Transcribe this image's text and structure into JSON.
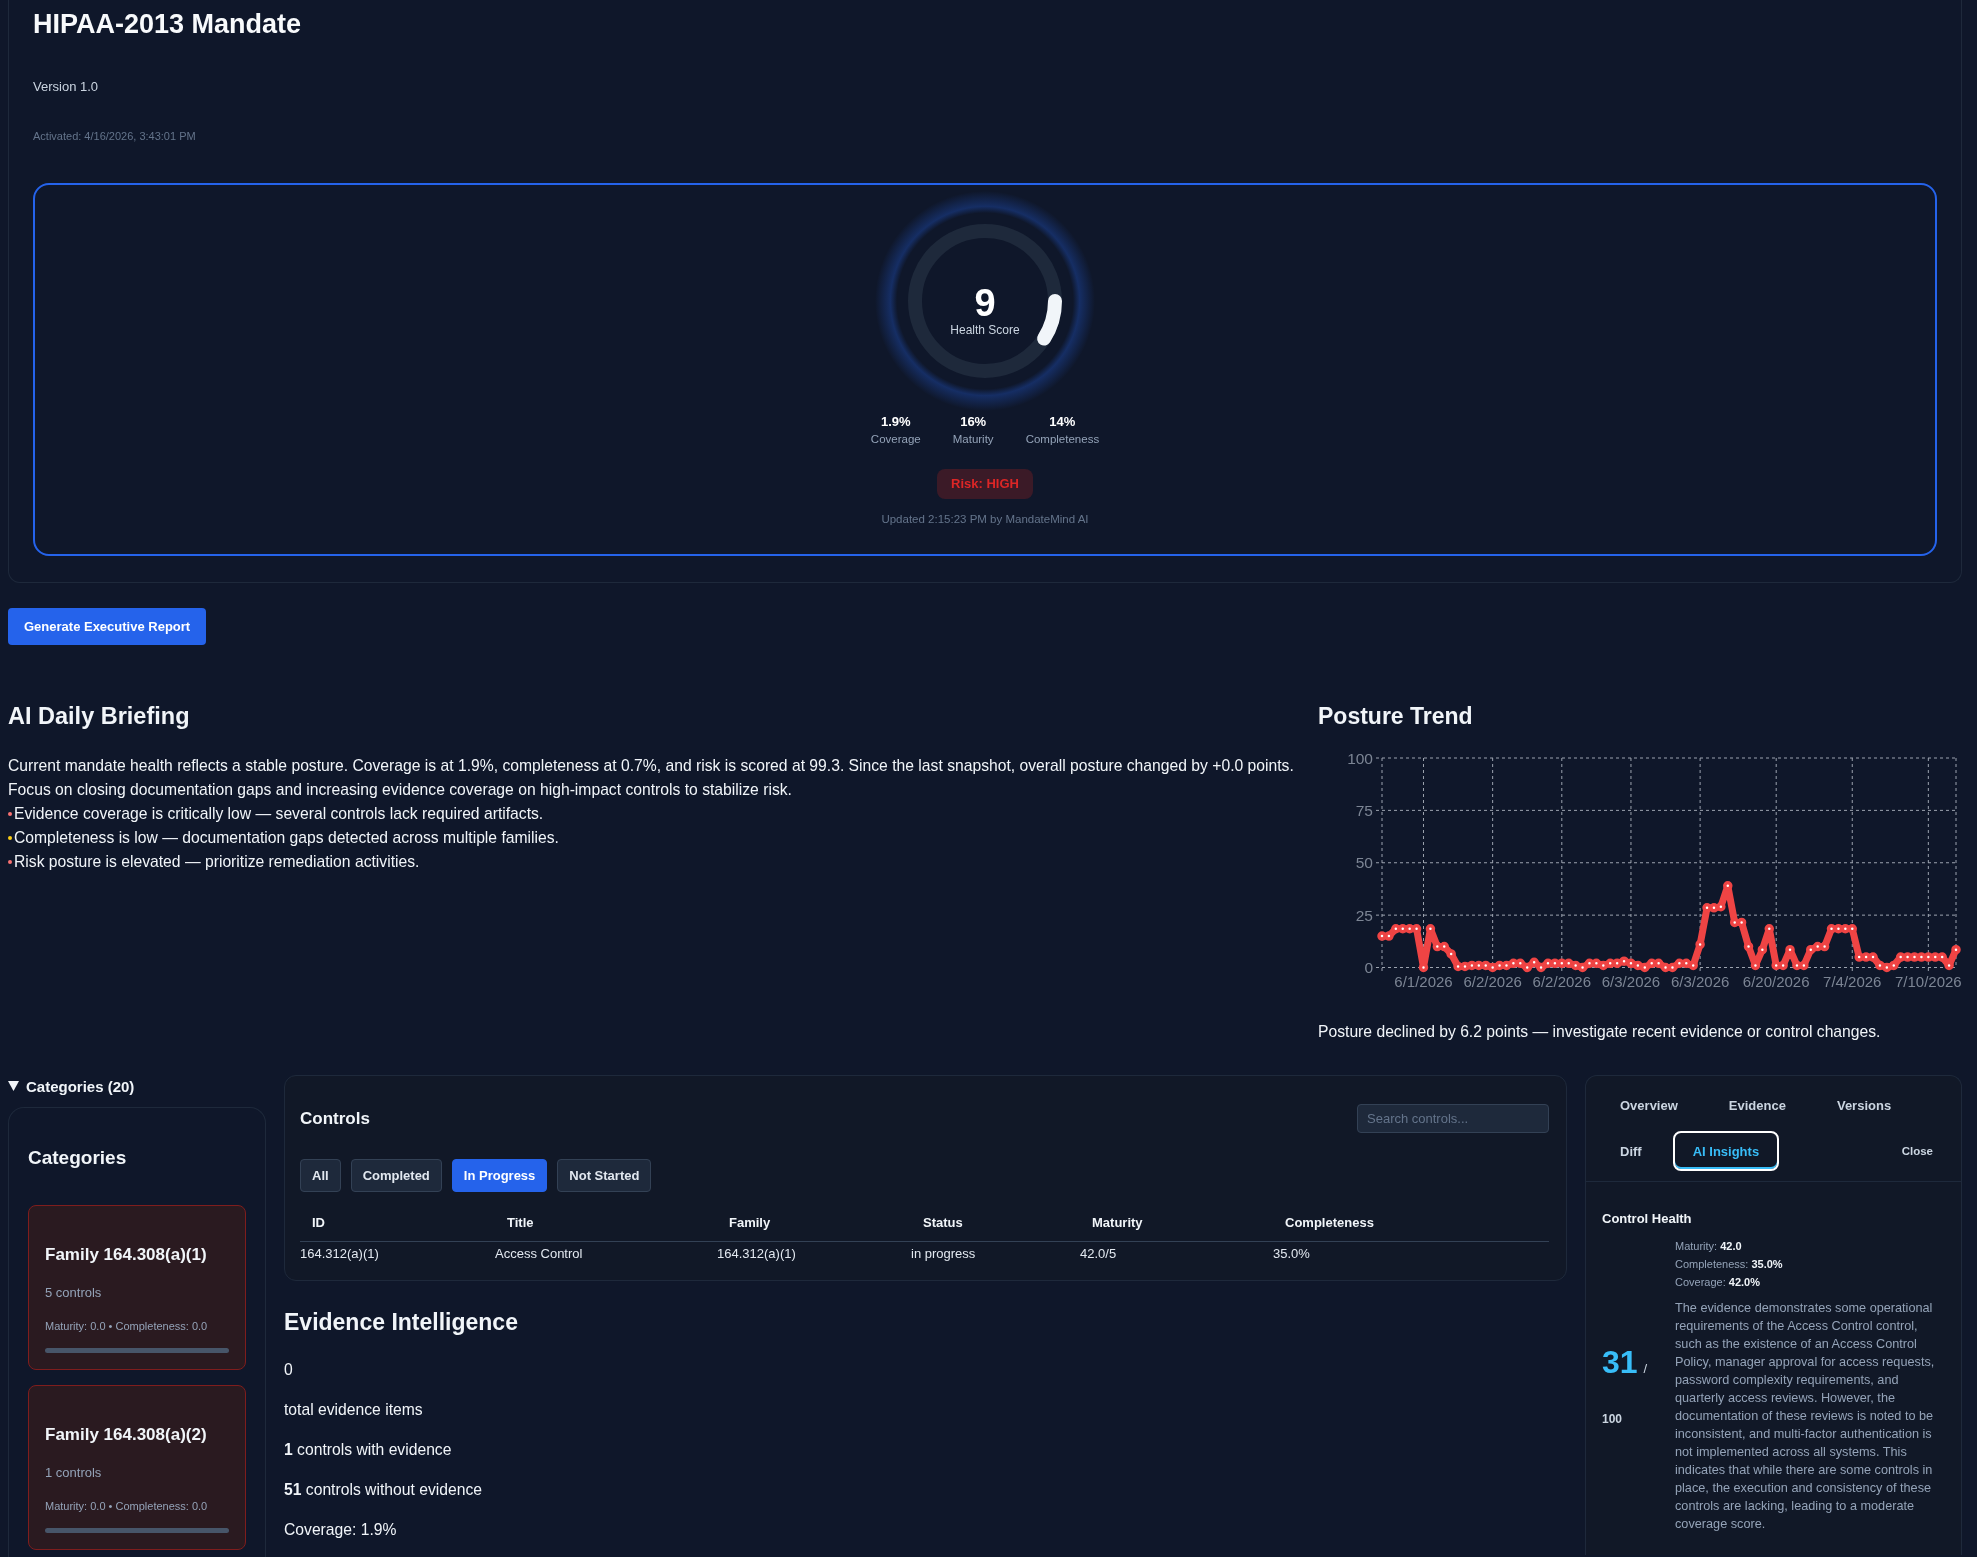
{
  "mandate": {
    "title": "HIPAA-2013 Mandate",
    "version": "Version 1.0",
    "activated": "Activated: 4/16/2026, 3:43:01 PM"
  },
  "health": {
    "score": "9",
    "label": "Health Score",
    "level": 0.09,
    "metrics": [
      {
        "value": "1.9%",
        "label": "Coverage"
      },
      {
        "value": "16%",
        "label": "Maturity"
      },
      {
        "value": "14%",
        "label": "Completeness"
      }
    ],
    "risk": {
      "label": "Risk: HIGH"
    },
    "updated": "Updated 2:15:23 PM by MandateMind AI"
  },
  "report_button": {
    "label": "Generate Executive Report"
  },
  "briefing": {
    "title": "AI Daily Briefing",
    "summary": "Current mandate health reflects a stable posture. Coverage is at 1.9%, completeness at 0.7%, and risk is scored at 99.3. Since the last snapshot, overall posture changed by +0.0 points. Focus on closing documentation gaps and increasing evidence coverage on high-impact controls to stabilize risk.",
    "bullets": [
      {
        "text": "Evidence coverage is critically low — several controls lack required artifacts.",
        "color": "#f87171"
      },
      {
        "text": "Completeness is low — documentation gaps detected across multiple families.",
        "color": "#facc15"
      },
      {
        "text": "Risk posture is elevated — prioritize remediation activities.",
        "color": "#f87171"
      }
    ]
  },
  "posture_trend": {
    "title": "Posture Trend",
    "chart_data": {
      "type": "line",
      "grid": true,
      "categories": [
        null,
        null,
        null,
        null,
        null,
        null,
        "6/1/2026",
        null,
        null,
        null,
        null,
        null,
        null,
        null,
        null,
        null,
        "6/2/2026",
        null,
        null,
        null,
        null,
        null,
        null,
        null,
        null,
        null,
        "6/2/2026",
        null,
        null,
        null,
        null,
        null,
        null,
        null,
        null,
        null,
        "6/3/2026",
        null,
        null,
        null,
        null,
        null,
        null,
        null,
        null,
        null,
        "6/3/2026",
        null,
        null,
        null,
        null,
        null,
        null,
        null,
        null,
        null,
        null,
        "6/20/2026",
        null,
        null,
        null,
        null,
        null,
        null,
        null,
        null,
        null,
        null,
        "7/4/2026",
        null,
        null,
        null,
        null,
        null,
        null,
        null,
        null,
        null,
        null,
        "7/10/2026",
        null,
        null,
        null,
        null
      ],
      "ylim": [
        0,
        100
      ],
      "yticks": [
        0,
        25,
        50,
        75,
        100
      ],
      "series": [
        {
          "color": "#ef4444",
          "marker": "circle",
          "values": [
            15,
            15,
            18.5,
            18.5,
            18.5,
            18.5,
            0,
            18.5,
            10,
            10,
            6.5,
            0.5,
            0.5,
            1,
            1,
            1,
            0,
            1,
            1,
            2,
            2,
            0,
            2.5,
            0,
            2,
            2,
            2,
            2,
            1,
            0,
            2,
            2,
            1,
            2,
            2,
            3,
            2,
            1,
            0,
            2,
            2,
            0,
            0,
            2,
            2,
            1,
            11,
            28.5,
            28.5,
            29,
            39,
            21.5,
            21.5,
            10,
            1,
            8.5,
            18.5,
            1,
            1,
            8.5,
            1,
            1,
            8.5,
            10,
            10,
            18.5,
            18.5,
            18.5,
            18.5,
            5,
            5,
            5,
            1,
            0,
            1,
            5,
            5,
            5,
            5,
            5,
            5,
            5,
            1,
            8.5
          ]
        }
      ]
    },
    "caption": "Posture declined by 6.2 points — investigate recent evidence or control changes."
  },
  "categories": {
    "summary": "Categories (20)",
    "expanded": true,
    "title": "Categories",
    "families": [
      {
        "name": "Family 164.308(a)(1)",
        "controls": "5 controls",
        "stats": "Maturity: 0.0 • Completeness: 0.0",
        "level": 0
      },
      {
        "name": "Family 164.308(a)(2)",
        "controls": "1 controls",
        "stats": "Maturity: 0.0 • Completeness: 0.0",
        "level": 0
      }
    ]
  },
  "controls": {
    "title": "Controls",
    "search": {
      "placeholder": "Search controls..."
    },
    "filters": [
      {
        "label": "All",
        "selected": false
      },
      {
        "label": "Completed",
        "selected": false
      },
      {
        "label": "In Progress",
        "selected": true
      },
      {
        "label": "Not Started",
        "selected": false
      }
    ],
    "table": {
      "columns": [
        "ID",
        "Title",
        "Family",
        "Status",
        "Maturity",
        "Completeness"
      ],
      "rows": [
        [
          "164.312(a)(1)",
          "Access Control",
          "164.312(a)(1)",
          "in progress",
          "42.0/5",
          "35.0%"
        ]
      ]
    }
  },
  "evidence_intelligence": {
    "title": "Evidence Intelligence",
    "lines": [
      "0",
      "total evidence items",
      "**1** controls with evidence",
      "**51** controls without evidence",
      "Coverage: 1.9%"
    ]
  },
  "detail_panel": {
    "tabs": [
      {
        "label": "Overview",
        "selected": false
      },
      {
        "label": "Evidence",
        "selected": false
      },
      {
        "label": "Versions",
        "selected": false
      },
      {
        "label": "Diff",
        "selected": false
      },
      {
        "label": "AI Insights",
        "selected": true
      }
    ],
    "close": "Close",
    "section_title": "Control Health",
    "score_value": "31",
    "score_separator": "/",
    "score_max": "100",
    "metrics": [
      "Maturity: **42.0**",
      "Completeness: **35.0%**",
      "Coverage: **42.0%**"
    ],
    "analysis": "The evidence demonstrates some operational requirements of the Access Control control, such as the existence of an Access Control Policy, manager approval for access requests, password complexity requirements, and quarterly access reviews. However, the documentation of these reviews is noted to be inconsistent, and multi-factor authentication is not implemented across all systems. This indicates that while there are some controls in place, the execution and consistency of these controls are lacking, leading to a moderate coverage score."
  }
}
